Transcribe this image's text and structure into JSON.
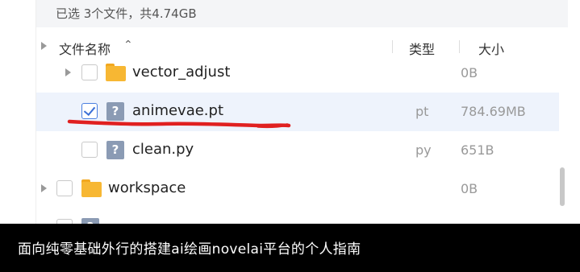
{
  "selection_summary": "已选 3个文件，共4.74GB",
  "header": {
    "name_label": "文件名称",
    "sort_icon": "sort-icon",
    "type_label": "类型",
    "size_label": "大小"
  },
  "rows": [
    {
      "name": "vector_adjust",
      "type": "",
      "size": "0B",
      "icon": "folder-icon",
      "checked": false,
      "expandable": true
    },
    {
      "name": "animevae.pt",
      "type": "pt",
      "size": "784.69MB",
      "icon": "unknown-file-icon",
      "checked": true,
      "expandable": false
    },
    {
      "name": "clean.py",
      "type": "py",
      "size": "651B",
      "icon": "unknown-file-icon",
      "checked": false,
      "expandable": false
    },
    {
      "name": "workspace",
      "type": "",
      "size": "0B",
      "icon": "folder-icon",
      "checked": false,
      "expandable": true
    }
  ],
  "caption": "面向纯零基础外行的搭建ai绘画novelai平台的个人指南",
  "colors": {
    "accent": "#3a6fd6",
    "selected_row": "#eef3fc",
    "folder": "#f7b733",
    "annotation_marker": "#e02020",
    "caption_bg": "#000000"
  }
}
